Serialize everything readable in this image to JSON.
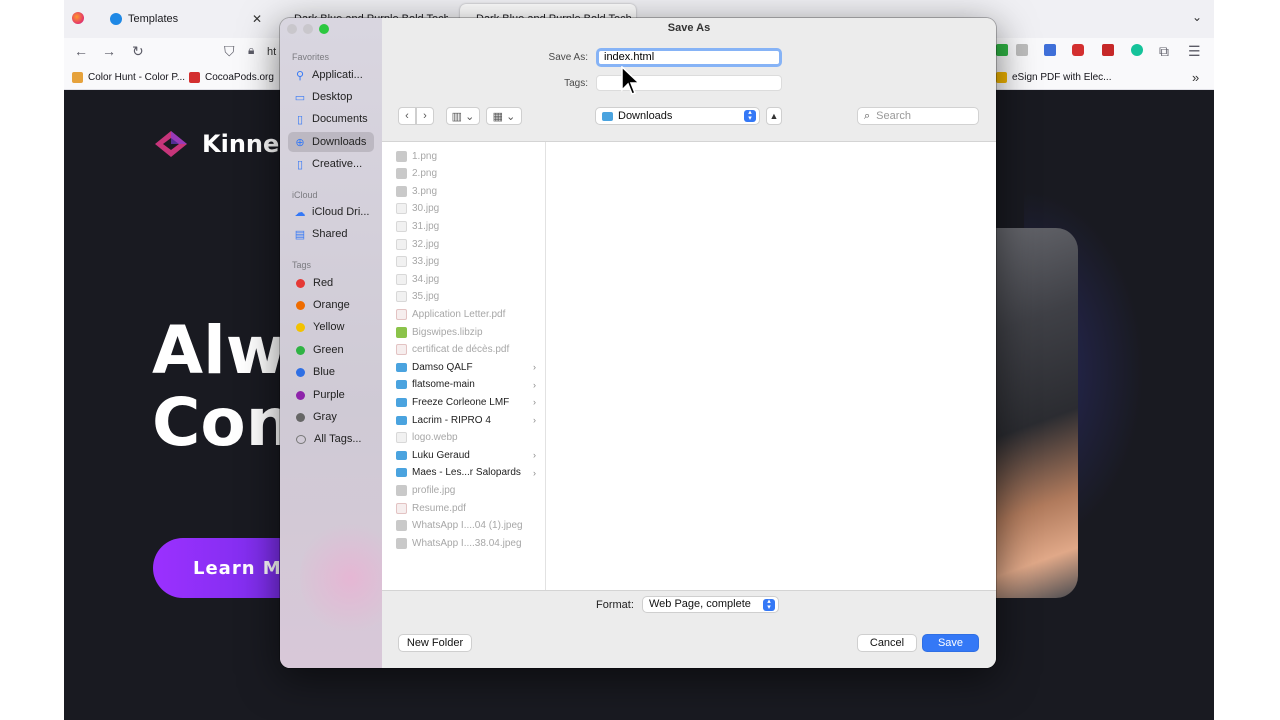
{
  "browser": {
    "tabs": [
      {
        "label": "Templates",
        "favicon_color": "#1e88e5"
      },
      {
        "label": "Dark Blue and Purple Bold Tech",
        "favicon_color": "#222"
      },
      {
        "label": "Dark Blue and Purple Bold Tech",
        "favicon_color": "#222"
      }
    ],
    "url_partial": "ht",
    "bookmarks": [
      {
        "label": "Color Hunt - Color P...",
        "color": "#e6a23c"
      },
      {
        "label": "CocoaPods.org",
        "color": "#d32f2f"
      },
      {
        "label": "eSign PDF with Elec...",
        "color": "#f0b400"
      }
    ]
  },
  "page": {
    "brand": "Kinne",
    "headline_line1": "Alw",
    "headline_line2": "Con",
    "cta": "Learn M",
    "accent": "#8b3dff"
  },
  "dialog": {
    "title": "Save As",
    "save_as_label": "Save As:",
    "save_as_value": "index.html",
    "tags_label": "Tags:",
    "location": "Downloads",
    "search_placeholder": "Search",
    "sidebar": {
      "favorites_title": "Favorites",
      "favorites": [
        {
          "label": "Applicati...",
          "icon": "applications-icon"
        },
        {
          "label": "Desktop",
          "icon": "desktop-icon"
        },
        {
          "label": "Documents",
          "icon": "documents-icon"
        },
        {
          "label": "Downloads",
          "icon": "downloads-icon",
          "selected": true
        },
        {
          "label": "Creative...",
          "icon": "file-icon"
        }
      ],
      "icloud_title": "iCloud",
      "icloud": [
        {
          "label": "iCloud Dri...",
          "icon": "cloud-icon"
        },
        {
          "label": "Shared",
          "icon": "shared-folder-icon"
        }
      ],
      "tags_title": "Tags",
      "tags": [
        {
          "label": "Red",
          "color": "#e53935"
        },
        {
          "label": "Orange",
          "color": "#ef6c00"
        },
        {
          "label": "Yellow",
          "color": "#f2c200"
        },
        {
          "label": "Green",
          "color": "#2fb344"
        },
        {
          "label": "Blue",
          "color": "#2f6fe4"
        },
        {
          "label": "Purple",
          "color": "#8e24aa"
        },
        {
          "label": "Gray",
          "color": "#666666"
        },
        {
          "label": "All Tags...",
          "color": ""
        }
      ]
    },
    "files": [
      {
        "name": "1.png",
        "kind": "img"
      },
      {
        "name": "2.png",
        "kind": "img"
      },
      {
        "name": "3.png",
        "kind": "img"
      },
      {
        "name": "30.jpg",
        "kind": "doc"
      },
      {
        "name": "31.jpg",
        "kind": "doc"
      },
      {
        "name": "32.jpg",
        "kind": "doc"
      },
      {
        "name": "33.jpg",
        "kind": "doc"
      },
      {
        "name": "34.jpg",
        "kind": "doc"
      },
      {
        "name": "35.jpg",
        "kind": "doc"
      },
      {
        "name": "Application Letter.pdf",
        "kind": "pdf"
      },
      {
        "name": "Bigswipes.libzip",
        "kind": "zip"
      },
      {
        "name": "certificat de décès.pdf",
        "kind": "pdf"
      },
      {
        "name": "Damso QALF",
        "kind": "folder"
      },
      {
        "name": "flatsome-main",
        "kind": "folder"
      },
      {
        "name": "Freeze Corleone LMF",
        "kind": "folder"
      },
      {
        "name": "Lacrim - RIPRO 4",
        "kind": "folder"
      },
      {
        "name": "logo.webp",
        "kind": "doc"
      },
      {
        "name": "Luku Geraud",
        "kind": "folder"
      },
      {
        "name": "Maes - Les...r Salopards",
        "kind": "folder"
      },
      {
        "name": "profile.jpg",
        "kind": "img"
      },
      {
        "name": "Resume.pdf",
        "kind": "pdf"
      },
      {
        "name": "WhatsApp I....04 (1).jpeg",
        "kind": "img"
      },
      {
        "name": "WhatsApp I....38.04.jpeg",
        "kind": "img"
      }
    ],
    "format_label": "Format:",
    "format_value": "Web Page, complete",
    "new_folder": "New Folder",
    "cancel": "Cancel",
    "save": "Save"
  }
}
